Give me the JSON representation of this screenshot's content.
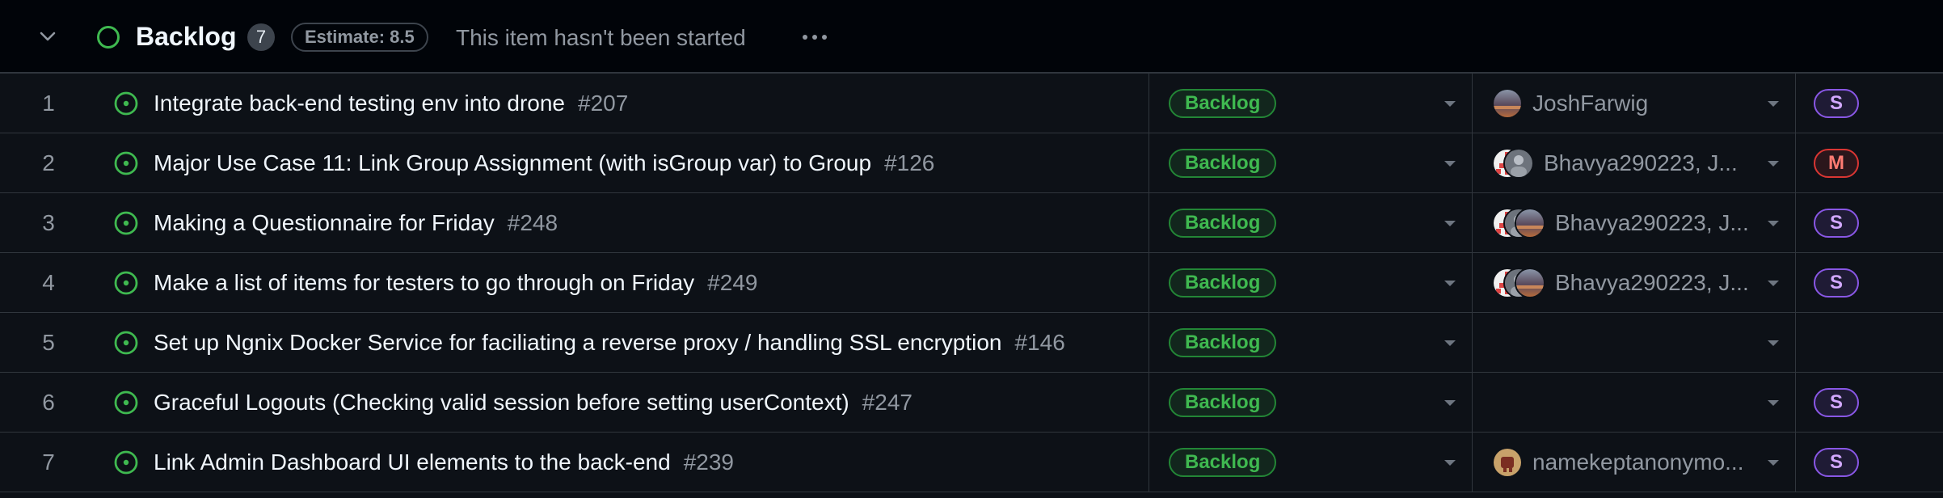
{
  "group": {
    "title": "Backlog",
    "count": "7",
    "estimate": "Estimate: 8.5",
    "description": "This item hasn't been started"
  },
  "colors": {
    "status_green": "#3fb950",
    "size_s_purple": "#d2a8ff",
    "size_m_red": "#ff7b72",
    "background": "#0d1117"
  },
  "icons": {
    "collapse": "chevron-down-icon",
    "group_status": "circle-outline-icon",
    "issue_open": "issue-open-icon",
    "more": "kebab-horizontal-icon"
  },
  "rows": [
    {
      "num": "1",
      "title": "Integrate back-end testing env into drone",
      "number": "#207",
      "status": "Backlog",
      "assignees": "JoshFarwig",
      "avatar_kind": "single-photo",
      "size": "S"
    },
    {
      "num": "2",
      "title": "Major Use Case 11: Link Group Assignment (with isGroup var) to Group",
      "number": "#126",
      "status": "Backlog",
      "assignees": "Bhavya290223, J...",
      "avatar_kind": "stack",
      "size": "M"
    },
    {
      "num": "3",
      "title": "Making a Questionnaire for Friday",
      "number": "#248",
      "status": "Backlog",
      "assignees": "Bhavya290223, J...",
      "avatar_kind": "stack3",
      "size": "S"
    },
    {
      "num": "4",
      "title": "Make a list of items for testers to go through on Friday",
      "number": "#249",
      "status": "Backlog",
      "assignees": "Bhavya290223, J...",
      "avatar_kind": "stack3",
      "size": "S"
    },
    {
      "num": "5",
      "title": "Set up Ngnix Docker Service for faciliating a reverse proxy / handling SSL encryption",
      "number": "#146",
      "status": "Backlog",
      "assignees": "",
      "avatar_kind": "none",
      "size": ""
    },
    {
      "num": "6",
      "title": "Graceful Logouts (Checking valid session before setting userContext)",
      "number": "#247",
      "status": "Backlog",
      "assignees": "",
      "avatar_kind": "none",
      "size": "S"
    },
    {
      "num": "7",
      "title": "Link Admin Dashboard UI elements to the back-end",
      "number": "#239",
      "status": "Backlog",
      "assignees": "namekeptanonymo...",
      "avatar_kind": "single-brown",
      "size": "S"
    }
  ]
}
